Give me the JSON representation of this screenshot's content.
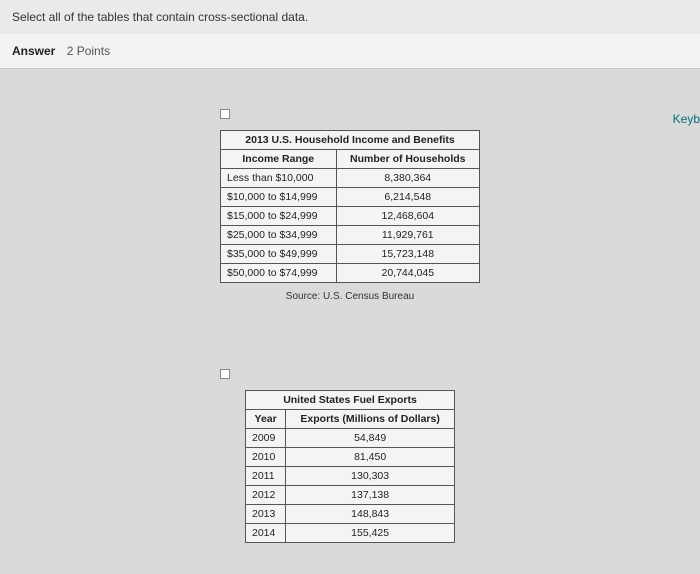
{
  "question": "Select all of the tables that contain cross-sectional data.",
  "answer_label": "Answer",
  "points_label": "2 Points",
  "keyb_label": "Keyb",
  "table1": {
    "title": "2013 U.S. Household Income and Benefits",
    "col1": "Income Range",
    "col2": "Number of Households",
    "rows": [
      {
        "range": "Less than $10,000",
        "count": "8,380,364"
      },
      {
        "range": "$10,000 to $14,999",
        "count": "6,214,548"
      },
      {
        "range": "$15,000 to $24,999",
        "count": "12,468,604"
      },
      {
        "range": "$25,000 to $34,999",
        "count": "11,929,761"
      },
      {
        "range": "$35,000 to $49,999",
        "count": "15,723,148"
      },
      {
        "range": "$50,000 to $74,999",
        "count": "20,744,045"
      }
    ],
    "source": "Source: U.S. Census Bureau"
  },
  "table2": {
    "title": "United States Fuel Exports",
    "col1": "Year",
    "col2": "Exports (Millions of Dollars)",
    "rows": [
      {
        "year": "2009",
        "val": "54,849"
      },
      {
        "year": "2010",
        "val": "81,450"
      },
      {
        "year": "2011",
        "val": "130,303"
      },
      {
        "year": "2012",
        "val": "137,138"
      },
      {
        "year": "2013",
        "val": "148,843"
      },
      {
        "year": "2014",
        "val": "155,425"
      }
    ]
  },
  "chart_data": [
    {
      "type": "table",
      "title": "2013 U.S. Household Income and Benefits",
      "columns": [
        "Income Range",
        "Number of Households"
      ],
      "data": [
        [
          "Less than $10,000",
          8380364
        ],
        [
          "$10,000 to $14,999",
          6214548
        ],
        [
          "$15,000 to $24,999",
          12468604
        ],
        [
          "$25,000 to $34,999",
          11929761
        ],
        [
          "$35,000 to $49,999",
          15723148
        ],
        [
          "$50,000 to $74,999",
          20744045
        ]
      ]
    },
    {
      "type": "table",
      "title": "United States Fuel Exports",
      "columns": [
        "Year",
        "Exports (Millions of Dollars)"
      ],
      "data": [
        [
          2009,
          54849
        ],
        [
          2010,
          81450
        ],
        [
          2011,
          130303
        ],
        [
          2012,
          137138
        ],
        [
          2013,
          148843
        ],
        [
          2014,
          155425
        ]
      ]
    }
  ]
}
